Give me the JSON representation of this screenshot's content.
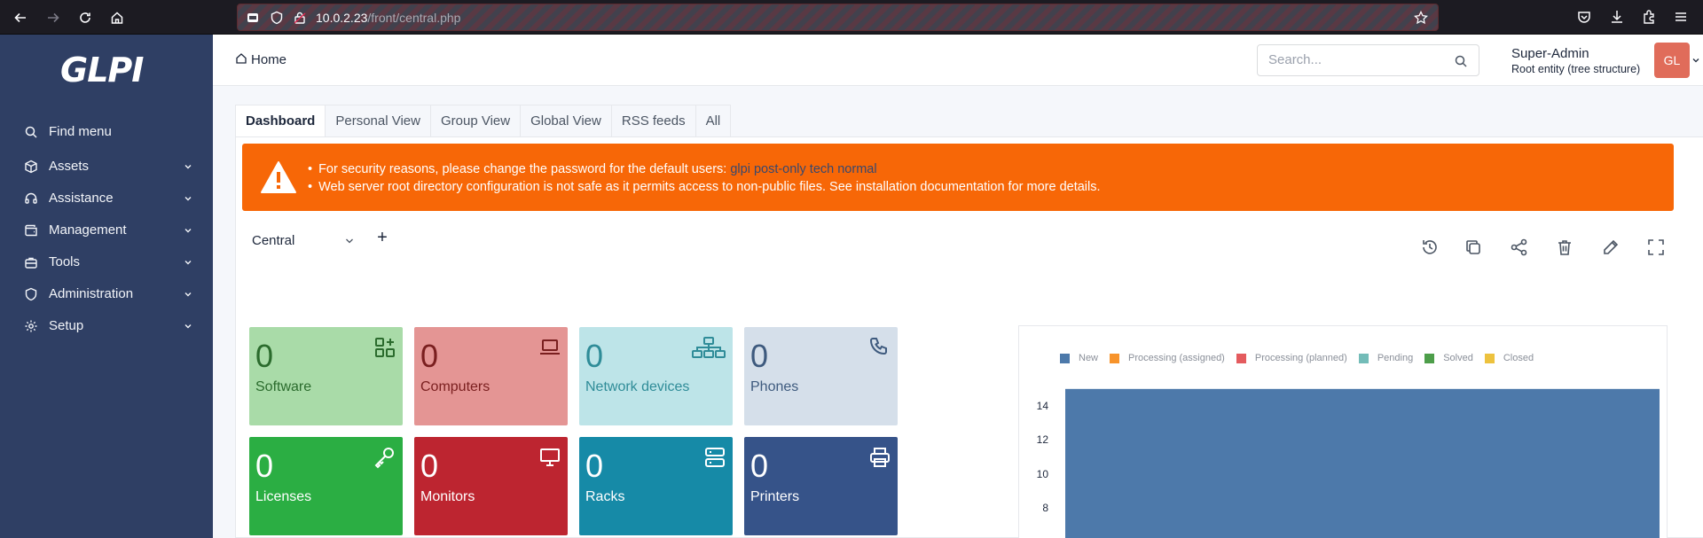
{
  "browser": {
    "url_host": "10.0.2.23",
    "url_path": "/front/central.php"
  },
  "sidebar": {
    "logo": "GLPI",
    "items": [
      {
        "label": "Find menu",
        "icon": "search-icon"
      },
      {
        "label": "Assets",
        "icon": "box-icon"
      },
      {
        "label": "Assistance",
        "icon": "headset-icon"
      },
      {
        "label": "Management",
        "icon": "wallet-icon"
      },
      {
        "label": "Tools",
        "icon": "briefcase-icon"
      },
      {
        "label": "Administration",
        "icon": "shield-icon"
      },
      {
        "label": "Setup",
        "icon": "gear-icon"
      }
    ]
  },
  "header": {
    "breadcrumb": "Home",
    "search_placeholder": "Search...",
    "user_name": "Super-Admin",
    "user_entity": "Root entity (tree structure)",
    "avatar_initials": "GL"
  },
  "tabs": [
    {
      "label": "Dashboard",
      "active": true
    },
    {
      "label": "Personal View",
      "active": false
    },
    {
      "label": "Group View",
      "active": false
    },
    {
      "label": "Global View",
      "active": false
    },
    {
      "label": "RSS feeds",
      "active": false
    },
    {
      "label": "All",
      "active": false
    }
  ],
  "alert": {
    "line1_text": "For security reasons, please change the password for the default users:",
    "line1_link": "glpi post-only tech normal",
    "line2_text": "Web server root directory configuration is not safe as it permits access to non-public files. See installation documentation for more details.",
    "color": "#f76707"
  },
  "dashboard": {
    "selected": "Central",
    "add_label": "+",
    "tools": [
      "history-icon",
      "copy-icon",
      "share-icon",
      "trash-icon",
      "edit-icon",
      "fullscreen-icon"
    ]
  },
  "cards": [
    {
      "value": "0",
      "label": "Software",
      "icon": "apps-icon",
      "bg": "#a9dba8",
      "fg": "#2b6b2d"
    },
    {
      "value": "0",
      "label": "Computers",
      "icon": "laptop-icon",
      "bg": "#e49594",
      "fg": "#7a1f1f"
    },
    {
      "value": "0",
      "label": "Network devices",
      "icon": "network-icon",
      "bg": "#bde4e8",
      "fg": "#2f8c98"
    },
    {
      "value": "0",
      "label": "Phones",
      "icon": "phone-icon",
      "bg": "#d5dfea",
      "fg": "#3e5a7e"
    },
    {
      "value": "0",
      "label": "Licenses",
      "icon": "key-icon",
      "bg": "#2bae43",
      "fg": "#ffffff"
    },
    {
      "value": "0",
      "label": "Monitors",
      "icon": "monitor-icon",
      "bg": "#bd2530",
      "fg": "#ffffff"
    },
    {
      "value": "0",
      "label": "Racks",
      "icon": "server-icon",
      "bg": "#168aa7",
      "fg": "#ffffff"
    },
    {
      "value": "0",
      "label": "Printers",
      "icon": "printer-icon",
      "bg": "#365389",
      "fg": "#ffffff"
    }
  ],
  "chart_data": {
    "type": "bar",
    "series": [
      {
        "name": "New",
        "color": "#4d79aa",
        "values": [
          15
        ]
      },
      {
        "name": "Processing (assigned)",
        "color": "#f7932b",
        "values": [
          0
        ]
      },
      {
        "name": "Processing (planned)",
        "color": "#e45b5e",
        "values": [
          0
        ]
      },
      {
        "name": "Pending",
        "color": "#73bcb8",
        "values": [
          0
        ]
      },
      {
        "name": "Solved",
        "color": "#4d9e4a",
        "values": [
          0
        ]
      },
      {
        "name": "Closed",
        "color": "#edc23e",
        "values": [
          0
        ]
      }
    ],
    "yticks": [
      14,
      12,
      10,
      8
    ],
    "legend_position": "top-left"
  }
}
